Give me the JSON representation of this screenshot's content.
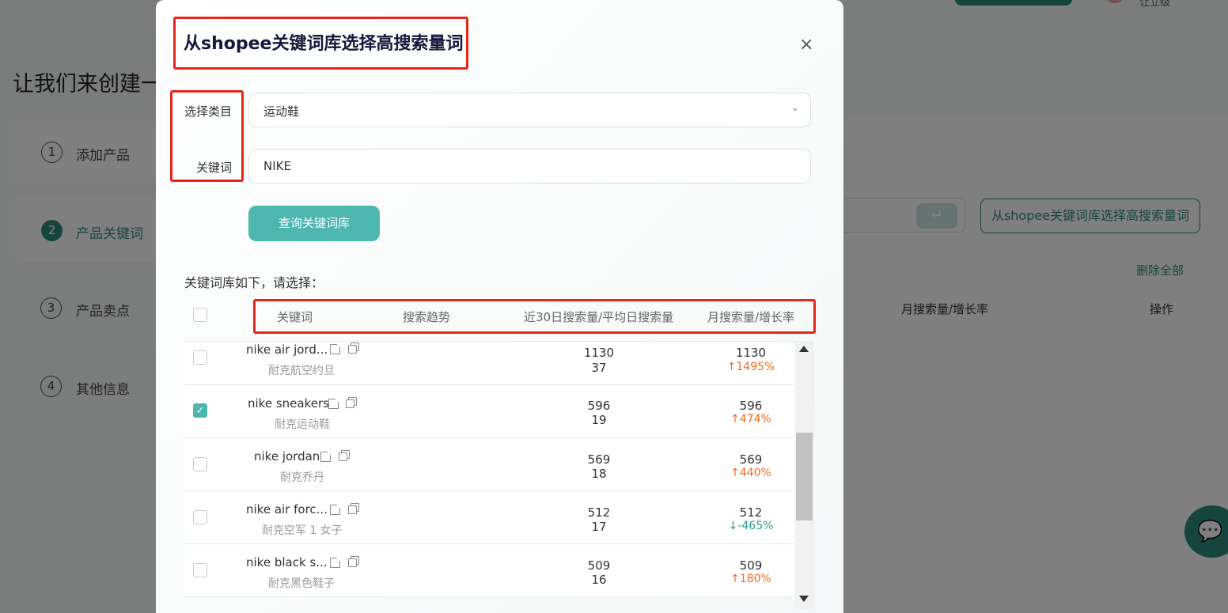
{
  "background": {
    "title": "让我们来创建一",
    "steps": [
      {
        "num": "1",
        "label": "添加产品"
      },
      {
        "num": "2",
        "label": "产品关键词"
      },
      {
        "num": "3",
        "label": "产品卖点"
      },
      {
        "num": "4",
        "label": "其他信息"
      }
    ],
    "pick_button": "从shopee关键词库选择高搜索量词",
    "delete_all": "删除全部",
    "col_monthly": "月搜索量/增长率",
    "col_action": "操作",
    "top_text": "让立级",
    "enter_glyph": "↵"
  },
  "modal": {
    "title": "从shopee关键词库选择高搜索量词",
    "close_glyph": "×",
    "category_label": "选择类目",
    "category_value": "运动鞋",
    "keyword_label": "关键词",
    "keyword_value": "NIKE",
    "query_button": "查询关键词库",
    "list_caption": "关键词库如下，请选择：",
    "headers": {
      "keyword": "关键词",
      "trend": "搜索趋势",
      "search30": "近30日搜索量/平均日搜索量",
      "monthly": "月搜索量/增长率"
    },
    "rows": [
      {
        "keyword": "nike air jord...",
        "translation": "耐克航空约旦",
        "search30": "1130",
        "daily": "37",
        "monthly": "1130",
        "rate": "↑1495%",
        "checked": false
      },
      {
        "keyword": "nike sneakers",
        "translation": "耐克运动鞋",
        "search30": "596",
        "daily": "19",
        "monthly": "596",
        "rate": "↑474%",
        "checked": true
      },
      {
        "keyword": "nike jordan",
        "translation": "耐克乔丹",
        "search30": "569",
        "daily": "18",
        "monthly": "569",
        "rate": "↑440%",
        "checked": false
      },
      {
        "keyword": "nike air forc...",
        "translation": "耐克空军 1 女子",
        "search30": "512",
        "daily": "17",
        "monthly": "512",
        "rate": "↓-465%",
        "checked": false
      },
      {
        "keyword": "nike black s...",
        "translation": "耐克黑色鞋子",
        "search30": "509",
        "daily": "16",
        "monthly": "509",
        "rate": "↑180%",
        "checked": false
      }
    ]
  },
  "colors": {
    "accent": "#4db6ae",
    "brand_dark": "#2c8a80",
    "highlight_red": "#e8241b",
    "rate_up": "#f36a1a",
    "rate_down": "#2a9d8f"
  }
}
